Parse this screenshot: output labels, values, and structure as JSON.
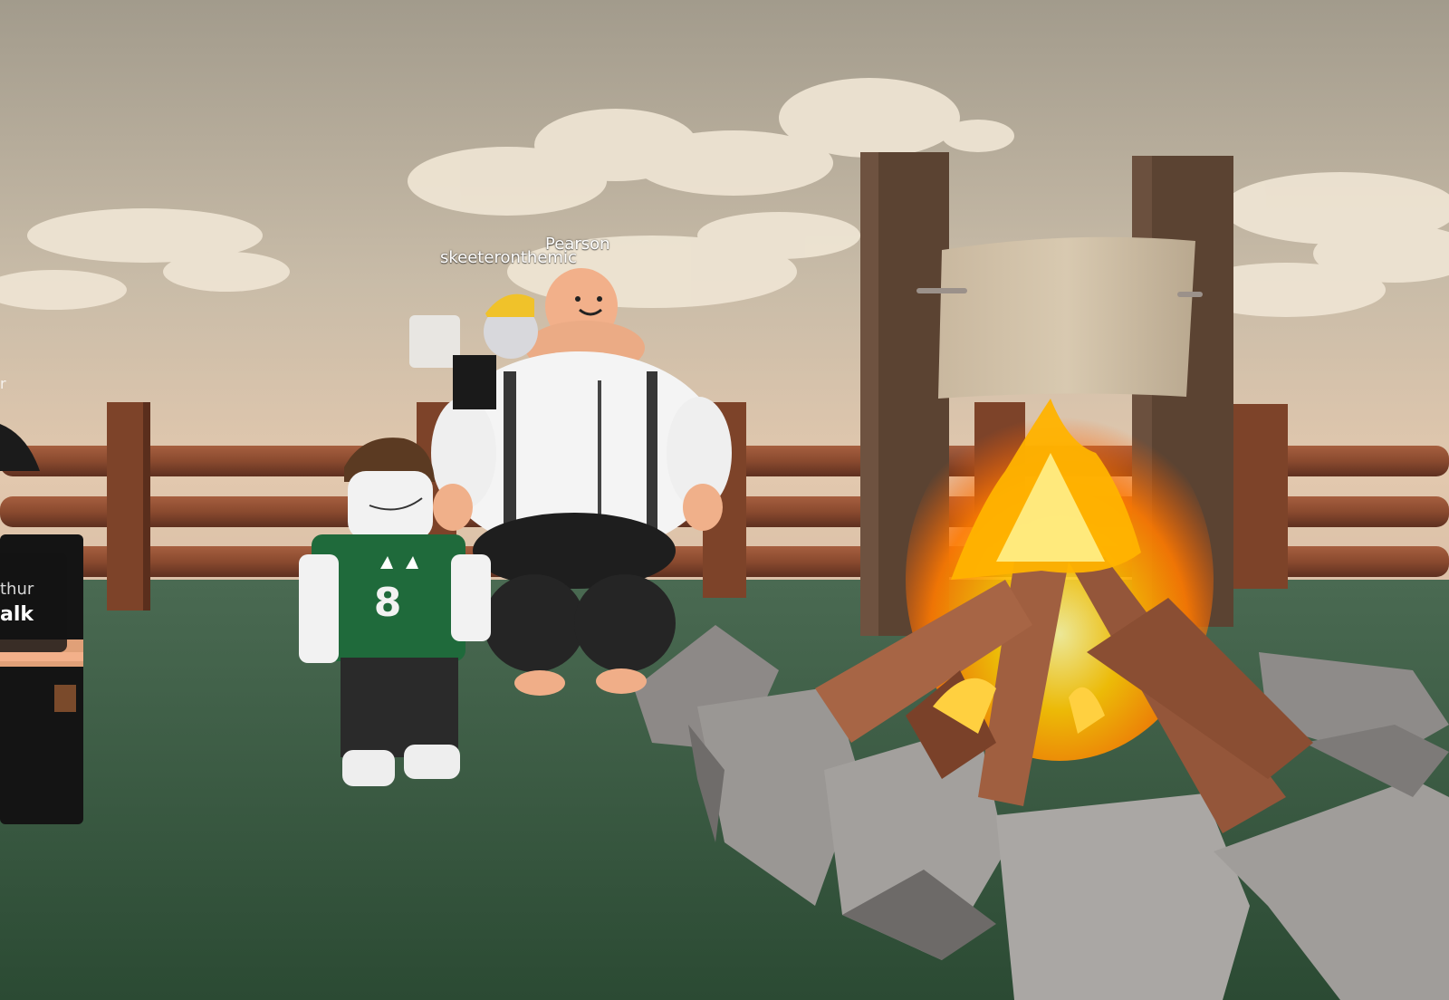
{
  "game": {
    "player_names": {
      "left": "skeeteronthemic",
      "right": "Pearson"
    },
    "interaction_prompt": {
      "object_label": "thur",
      "action_label": "alk"
    },
    "edge_name_fragment": "r"
  },
  "colors": {
    "sky": "#c9b9a4",
    "grass": "#33533b",
    "fence_wood": "#8a4b30",
    "fire": "#ffb000",
    "stone": "#8f8c8a"
  },
  "icons": [
    "campfire",
    "wooden-fence",
    "sign-board"
  ]
}
